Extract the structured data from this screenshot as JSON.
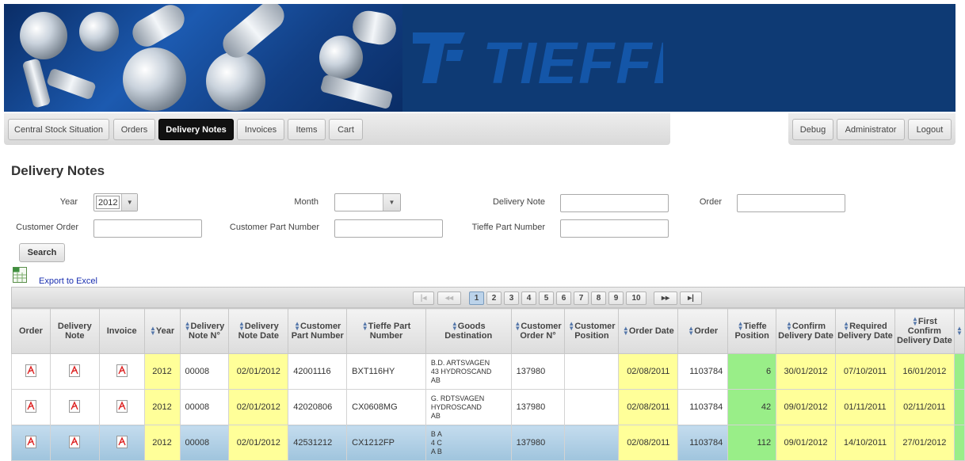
{
  "brand": {
    "name": "TIEFFE",
    "primary": "#0e3a74",
    "accent": "#1c5ab0"
  },
  "nav": {
    "items": [
      {
        "label": "Central Stock Situation",
        "active": false
      },
      {
        "label": "Orders",
        "active": false
      },
      {
        "label": "Delivery Notes",
        "active": true
      },
      {
        "label": "Invoices",
        "active": false
      },
      {
        "label": "Items",
        "active": false
      },
      {
        "label": "Cart",
        "active": false
      }
    ],
    "right_items": [
      {
        "label": "Debug"
      },
      {
        "label": "Administrator"
      },
      {
        "label": "Logout"
      }
    ]
  },
  "page_title": "Delivery Notes",
  "filters": {
    "year_label": "Year",
    "year_value": "2012",
    "month_label": "Month",
    "month_value": "",
    "delivery_note_label": "Delivery Note",
    "delivery_note_value": "",
    "order_label": "Order",
    "order_value": "",
    "customer_order_label": "Customer Order",
    "customer_order_value": "",
    "customer_part_label": "Customer Part Number",
    "customer_part_value": "",
    "tieffe_part_label": "Tieffe Part Number",
    "tieffe_part_value": "",
    "search_label": "Search"
  },
  "export": {
    "label": "Export to Excel",
    "icon": "excel-icon"
  },
  "pager": {
    "first": "|◂",
    "prev": "◂◂",
    "pages": [
      "1",
      "2",
      "3",
      "4",
      "5",
      "6",
      "7",
      "8",
      "9",
      "10"
    ],
    "current": "1",
    "next": "▸▸",
    "last": "▸|"
  },
  "table": {
    "columns": [
      {
        "label": "Order",
        "sortable": false
      },
      {
        "label": "Delivery Note",
        "sortable": false
      },
      {
        "label": "Invoice",
        "sortable": false
      },
      {
        "label": "Year",
        "sortable": true
      },
      {
        "label": "Delivery Note N°",
        "sortable": true
      },
      {
        "label": "Delivery Note Date",
        "sortable": true
      },
      {
        "label": "Customer Part Number",
        "sortable": true
      },
      {
        "label": "Tieffe Part Number",
        "sortable": true
      },
      {
        "label": "Goods Destination",
        "sortable": true
      },
      {
        "label": "Customer Order N°",
        "sortable": true
      },
      {
        "label": "Customer Position",
        "sortable": true
      },
      {
        "label": "Order Date",
        "sortable": true
      },
      {
        "label": "Order",
        "sortable": true
      },
      {
        "label": "Tieffe Position",
        "sortable": true
      },
      {
        "label": "Confirm Delivery Date",
        "sortable": true
      },
      {
        "label": "Required Delivery Date",
        "sortable": true
      },
      {
        "label": "First Confirm Delivery Date",
        "sortable": true
      }
    ],
    "rows": [
      {
        "year": "2012",
        "dn_no": "00008",
        "dn_date": "02/01/2012",
        "cust_part": "42001116",
        "tieffe_part": "BXT116HY",
        "destination": [
          "B.D. ARTSVAGEN",
          "43 HYDROSCAND",
          "AB"
        ],
        "cust_order": "137980",
        "cust_pos": "",
        "order_date": "02/08/2011",
        "order": "1103784",
        "tieffe_pos": "6",
        "confirm_date": "30/01/2012",
        "required_date": "07/10/2011",
        "first_confirm": "16/01/2012"
      },
      {
        "year": "2012",
        "dn_no": "00008",
        "dn_date": "02/01/2012",
        "cust_part": "42020806",
        "tieffe_part": "CX0608MG",
        "destination": [
          "G. RDTSVAGEN",
          "HYDROSCAND",
          "AB"
        ],
        "cust_order": "137980",
        "cust_pos": "",
        "order_date": "02/08/2011",
        "order": "1103784",
        "tieffe_pos": "42",
        "confirm_date": "09/01/2012",
        "required_date": "01/11/2011",
        "first_confirm": "02/11/2011"
      },
      {
        "year": "2012",
        "dn_no": "00008",
        "dn_date": "02/01/2012",
        "cust_part": "42531212",
        "tieffe_part": "CX1212FP",
        "destination": [
          "B        A",
          "4        C",
          "A B"
        ],
        "cust_order": "137980",
        "cust_pos": "",
        "order_date": "02/08/2011",
        "order": "1103784",
        "tieffe_pos": "112",
        "confirm_date": "09/01/2012",
        "required_date": "14/10/2011",
        "first_confirm": "27/01/2012"
      }
    ]
  }
}
